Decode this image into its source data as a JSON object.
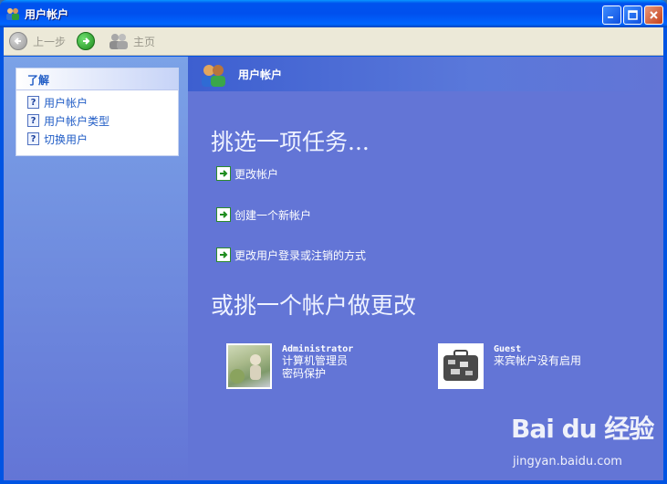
{
  "window": {
    "title": "用户帐户"
  },
  "toolbar": {
    "back_label": "上一步",
    "home_label": "主页"
  },
  "sidebar": {
    "panel_title": "了解",
    "items": [
      {
        "label": "用户帐户"
      },
      {
        "label": "用户帐户类型"
      },
      {
        "label": "切换用户"
      }
    ]
  },
  "main": {
    "header_title": "用户帐户",
    "pick_task_heading": "挑选一项任务...",
    "tasks": [
      {
        "label": "更改帐户"
      },
      {
        "label": "创建一个新帐户"
      },
      {
        "label": "更改用户登录或注销的方式"
      }
    ],
    "pick_account_heading": "或挑一个帐户做更改",
    "accounts": [
      {
        "name": "Administrator",
        "line1": "计算机管理员",
        "line2": "密码保护"
      },
      {
        "name": "Guest",
        "line1": "来宾帐户没有启用",
        "line2": ""
      }
    ]
  },
  "watermark": {
    "logo": "Bai du 经验",
    "url": "jingyan.baidu.com"
  },
  "icons": [
    "users-icon",
    "minimize-icon",
    "maximize-icon",
    "close-icon",
    "back-icon",
    "forward-icon",
    "home-icon",
    "help-icon",
    "task-arrow-icon"
  ],
  "colors": {
    "titlebar": "#0054e3",
    "sidebar": "#7ba2e7",
    "main_bg": "#6375d6",
    "link": "#215dc6",
    "toolbar": "#ece9d8"
  }
}
